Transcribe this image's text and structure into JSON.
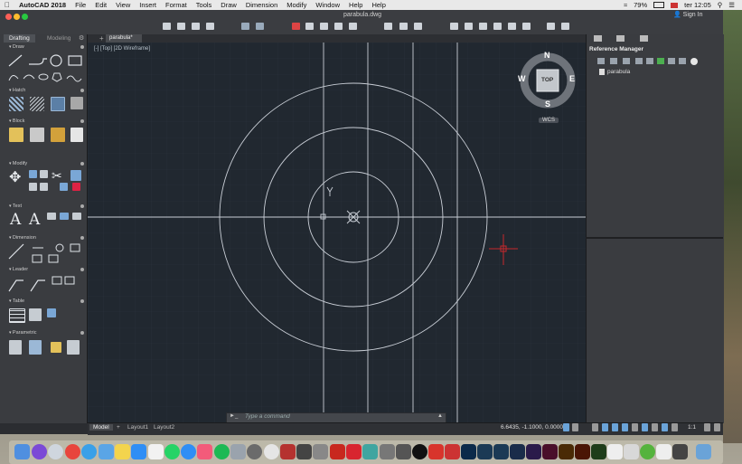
{
  "menubar": {
    "app_name": "AutoCAD 2018",
    "items": [
      "File",
      "Edit",
      "View",
      "Insert",
      "Format",
      "Tools",
      "Draw",
      "Dimension",
      "Modify",
      "Window",
      "Help",
      "Help"
    ],
    "battery": "79%",
    "clock": "ter 12:05"
  },
  "window": {
    "document_title": "parabula.dwg",
    "sign_in": "Sign In"
  },
  "palette": {
    "tabs": [
      "Drafting",
      "Modeling"
    ],
    "sections": [
      "Draw",
      "Hatch",
      "Block",
      "Modify",
      "Text",
      "Dimension",
      "Leader",
      "Table",
      "Parametric"
    ]
  },
  "drawing": {
    "tab_label": "parabula*",
    "viewport_label": "[-] [Top] [2D Wireframe]",
    "viewcube": {
      "top_label": "TOP",
      "north": "N",
      "south": "S",
      "east": "E",
      "west": "W",
      "wcs": "WCS"
    }
  },
  "reference_manager": {
    "title": "Reference Manager",
    "items": [
      "parabula"
    ]
  },
  "statusbar": {
    "layouts": [
      "Model",
      "Layout1",
      "Layout2"
    ],
    "coordinates": "6.6435, -1.1000, 0.0000",
    "scale": "1:1"
  },
  "command_line": {
    "placeholder": "Type a command"
  },
  "colors": {
    "canvas": "#212830",
    "grid_line": "#2a323c",
    "geometry": "#c9ced6",
    "crosshair": "#c8282c",
    "accent_blue": "#6aa3d8"
  }
}
